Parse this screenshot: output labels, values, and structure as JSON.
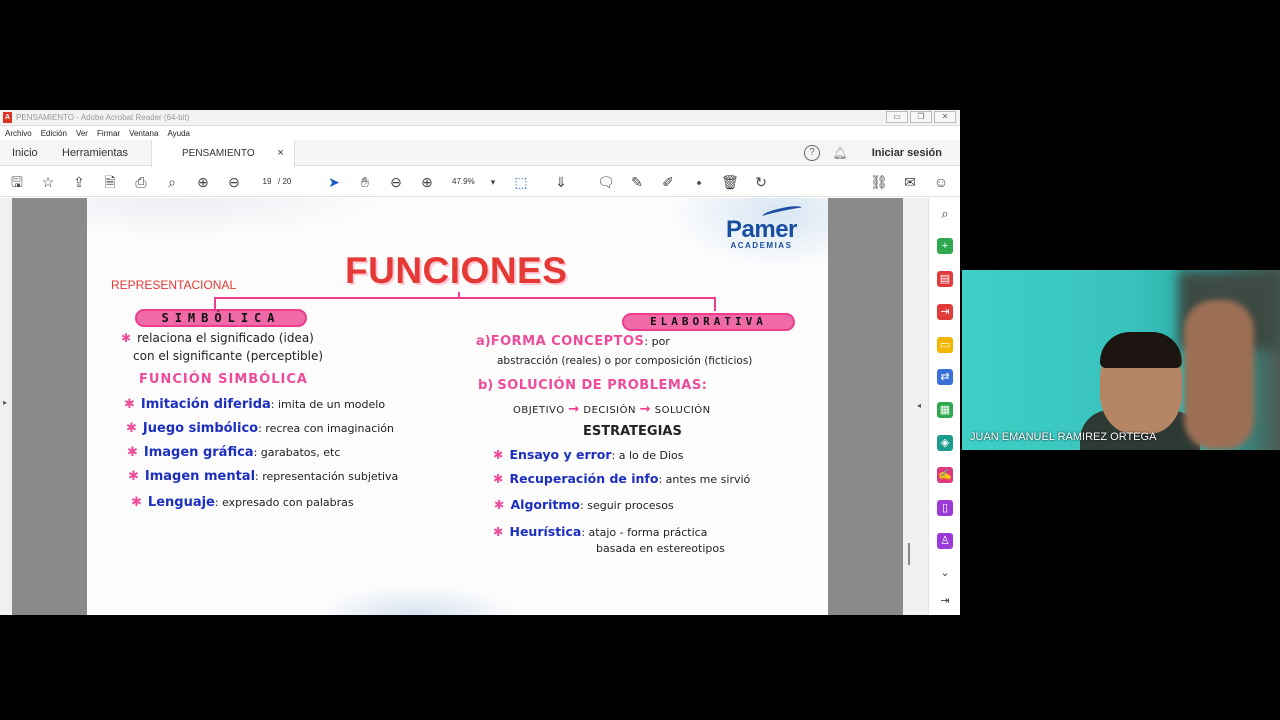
{
  "window": {
    "title": "PENSAMIENTO - Adobe Acrobat Reader (64-bit)",
    "controls": [
      "▭",
      "❐",
      "✕"
    ]
  },
  "menu": [
    "Archivo",
    "Edición",
    "Ver",
    "Firmar",
    "Ventana",
    "Ayuda"
  ],
  "tabs": {
    "home": "Inicio",
    "tools": "Herramientas",
    "document": "PENSAMIENTO",
    "close": "×"
  },
  "account": {
    "signin": "Iniciar sesión",
    "help_icon": "?"
  },
  "toolbar": {
    "page_current": "19",
    "page_total": "/ 20",
    "zoom": "47.9%"
  },
  "document": {
    "logo_name": "Pamer",
    "logo_sub": "ACADEMIAS",
    "title": "FUNCIONES",
    "label_left": "REPRESENTACIONAL",
    "pill_left": "SIMBÓLICA",
    "pill_right": "ELABORATIVA",
    "left": {
      "intro_line1": "relaciona el significado (idea)",
      "intro_line2": "con el significante (perceptible)",
      "subheading": "FUNCIÓN SIMBÓLICA",
      "items": [
        {
          "term": "Imitación diferida",
          "desc": ": imita de un modelo"
        },
        {
          "term": "Juego simbólico",
          "desc": ": recrea con imaginación"
        },
        {
          "term": "Imagen gráfica",
          "desc": ": garabatos, etc"
        },
        {
          "term": "Imagen mental",
          "desc": ": representación subjetiva"
        },
        {
          "term": "Lenguaje",
          "desc": ": expresado con palabras"
        }
      ]
    },
    "right": {
      "a_label": "a)",
      "a_term": "FORMA CONCEPTOS",
      "a_suffix": ": por",
      "a_line2": "abstracción (reales) o por composición (ficticios)",
      "b_label": "b)",
      "b_term": "SOLUCIÓN DE PROBLEMAS:",
      "flow": [
        "OBJETIVO",
        "DECISIÓN",
        "SOLUCIÓN"
      ],
      "strategies_heading": "ESTRATEGIAS",
      "strategies": [
        {
          "term": "Ensayo y error",
          "desc": ": a lo de Dios"
        },
        {
          "term": "Recuperación de info",
          "desc": ": antes me sirvió"
        },
        {
          "term": "Algoritmo",
          "desc": ": seguir procesos"
        },
        {
          "term": "Heurística",
          "desc": ": atajo - forma práctica"
        }
      ],
      "heuristic_line2": "basada en estereotipos"
    }
  },
  "webcam": {
    "participant_name": "JUAN EMANUEL RAMIREZ ORTEGA"
  },
  "colors": {
    "accent_pink": "#ee3d8f",
    "title_red": "#e53935",
    "ink_blue": "#1c2fbf",
    "brand_blue": "#1a4fa0"
  }
}
